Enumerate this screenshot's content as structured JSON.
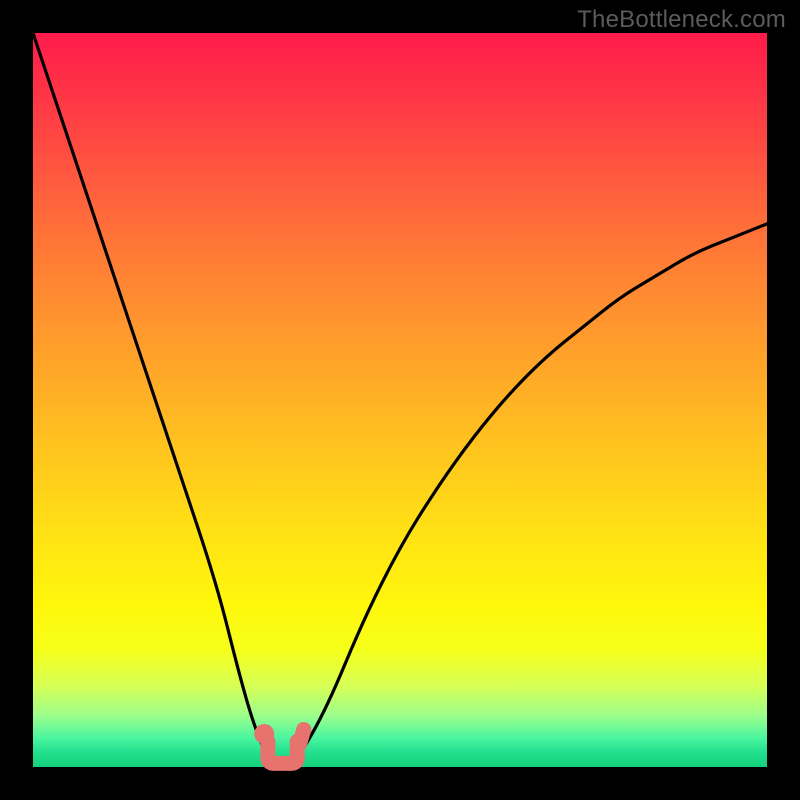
{
  "watermark": "TheBottleneck.com",
  "chart_data": {
    "type": "line",
    "title": "",
    "xlabel": "",
    "ylabel": "",
    "xlim": [
      0,
      100
    ],
    "ylim": [
      0,
      100
    ],
    "grid": false,
    "x": [
      0,
      5,
      10,
      15,
      20,
      25,
      28,
      30,
      32,
      33,
      34,
      35,
      36,
      40,
      45,
      50,
      55,
      60,
      65,
      70,
      75,
      80,
      85,
      90,
      95,
      100
    ],
    "series": [
      {
        "name": "bottleneck-curve",
        "values": [
          100,
          85,
          70,
          55,
          40,
          25,
          13,
          6,
          1,
          0,
          0,
          0,
          1,
          8,
          20,
          30,
          38,
          45,
          51,
          56,
          60,
          64,
          67,
          70,
          72,
          74
        ]
      }
    ],
    "annotations": [
      {
        "shape": "dot",
        "x": 31.5,
        "y": 4.5,
        "color": "#e7736f"
      },
      {
        "shape": "tick",
        "x": 36.5,
        "y": 4.0,
        "color": "#e7736f"
      },
      {
        "shape": "u-stroke",
        "x_from": 32,
        "x_to": 36,
        "y": 0.5,
        "color": "#e7736f"
      }
    ],
    "background_gradient": {
      "top": "#ff1b4a",
      "mid": "#ffe114",
      "bottom": "#14d07a"
    }
  }
}
